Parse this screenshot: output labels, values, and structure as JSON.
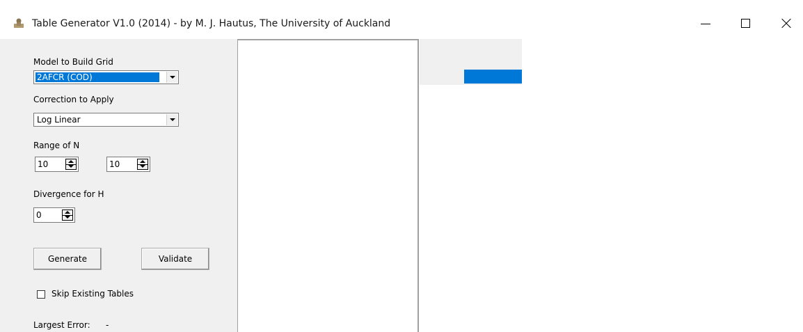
{
  "window": {
    "title": "Table Generator V1.0 (2014) - by M. J. Hautus, The University of Auckland",
    "icon": "app-figure-icon",
    "controls": {
      "minimize": "minimize-icon",
      "maximize": "maximize-icon",
      "close": "close-icon"
    }
  },
  "model": {
    "label": "Model to Build Grid",
    "selected": "2AFCR (COD)"
  },
  "correction": {
    "label": "Correction to Apply",
    "selected": "Log Linear"
  },
  "range_n": {
    "label": "Range of N",
    "min": "10",
    "max": "10"
  },
  "divergence": {
    "label": "Divergence for H",
    "value": "0"
  },
  "buttons": {
    "generate": "Generate",
    "validate": "Validate"
  },
  "skip_existing": {
    "label": "Skip Existing Tables",
    "checked": false
  },
  "largest_error": {
    "label": "Largest Error:",
    "value": "-"
  },
  "colors": {
    "selection": "#0078d7",
    "panel": "#f0f0f0"
  }
}
